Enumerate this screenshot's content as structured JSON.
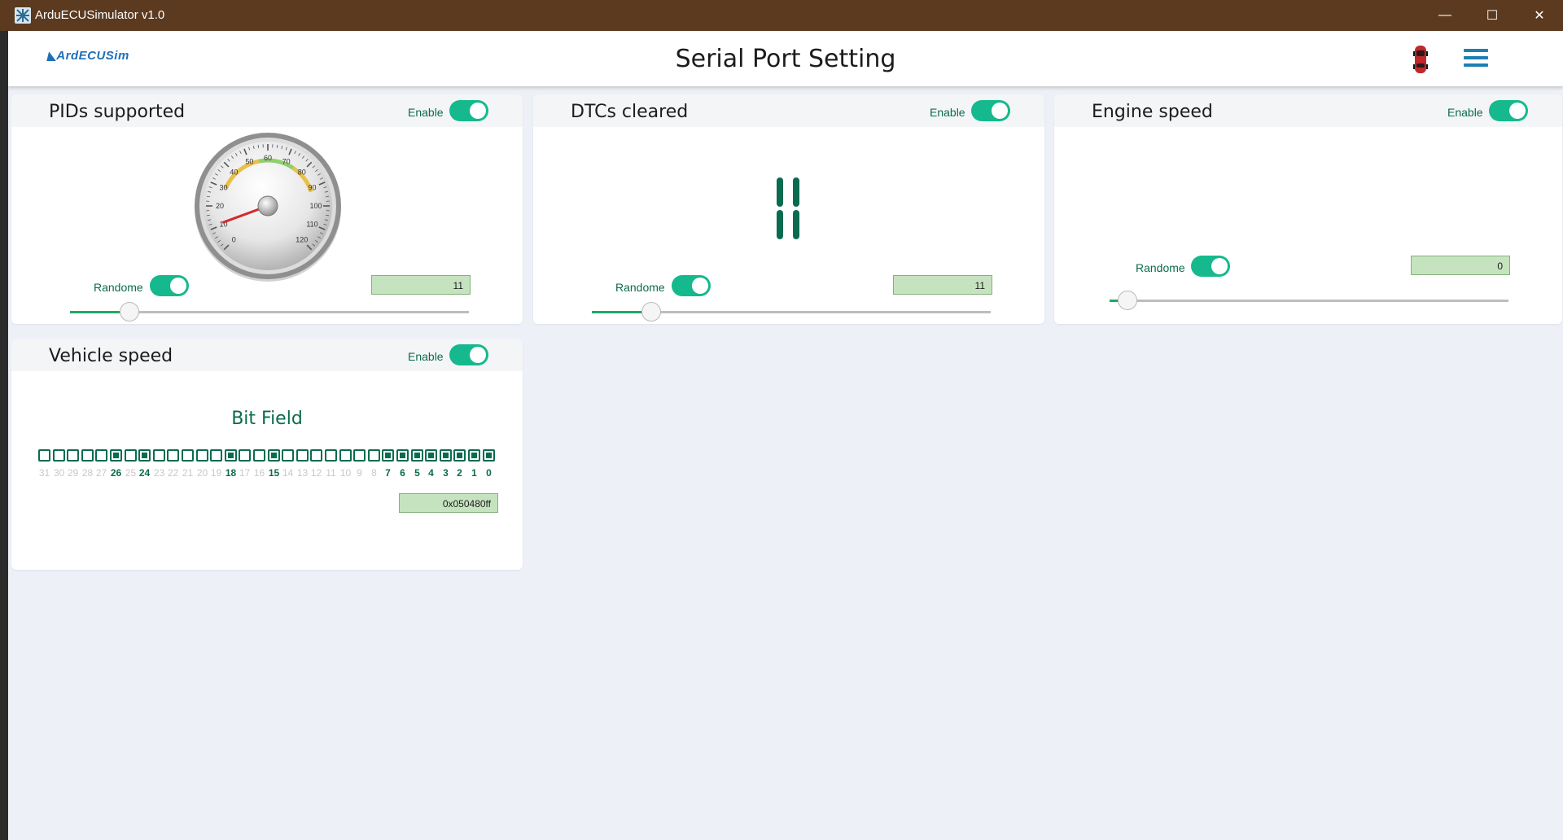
{
  "window": {
    "title": "ArduECUSimulator v1.0",
    "minimize_glyph": "—",
    "maximize_glyph": "☐",
    "close_glyph": "✕"
  },
  "appbar": {
    "logo_text": "ArdECUSim",
    "title": "Serial Port Setting",
    "icons": [
      "app-logo-icon",
      "car-icon",
      "hamburger-menu-icon"
    ]
  },
  "colors": {
    "accent": "#15b98d",
    "dark_green": "#0b6b4f",
    "value_box_bg": "#c6e3c0",
    "titlebar": "#5b3a1f",
    "menu_blue": "#1e7fb3"
  },
  "cards": {
    "pids": {
      "title": "PIDs supported",
      "enable_label": "Enable",
      "enabled": true,
      "randome_label": "Randome",
      "randome_on": true,
      "value": "11",
      "slider_fraction": 0.11,
      "gauge": {
        "ticks": [
          "0",
          "10",
          "20",
          "30",
          "40",
          "50",
          "60",
          "70",
          "80",
          "90",
          "100",
          "110",
          "120"
        ],
        "needle_value": 11
      }
    },
    "dtcs": {
      "title": "DTCs cleared",
      "enable_label": "Enable",
      "enabled": true,
      "randome_label": "Randome",
      "randome_on": true,
      "value": "11",
      "slider_fraction": 0.11,
      "display_value": "11"
    },
    "engine": {
      "title": "Engine speed",
      "enable_label": "Enable",
      "enabled": true,
      "randome_label": "Randome",
      "randome_on": true,
      "value": "0",
      "slider_fraction": 0
    },
    "vehicle": {
      "title": "Vehicle speed",
      "enable_label": "Enable",
      "enabled": true,
      "bitfield_title": "Bit Field",
      "bits_on": [
        26,
        24,
        18,
        15,
        7,
        6,
        5,
        4,
        3,
        2,
        1,
        0
      ],
      "hex_value": "0x050480ff"
    }
  }
}
